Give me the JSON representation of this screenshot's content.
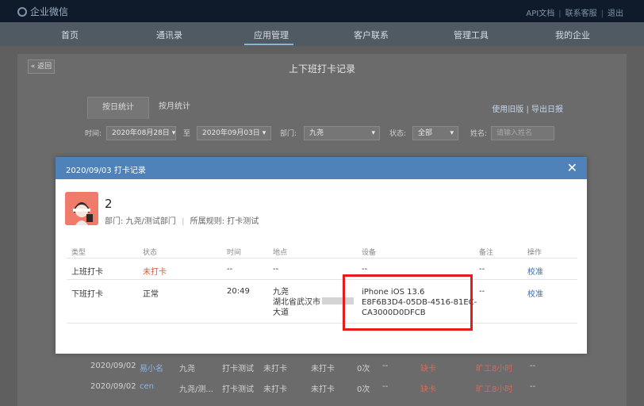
{
  "app": {
    "title": "企业微信",
    "toplinks": [
      "API文档",
      "联系客服",
      "退出"
    ]
  },
  "nav": {
    "items": [
      "首页",
      "通讯录",
      "应用管理",
      "客户联系",
      "管理工具",
      "我的企业"
    ],
    "active": "应用管理"
  },
  "page": {
    "back_label": "« 返回",
    "title": "上下班打卡记录"
  },
  "tabs": {
    "daily": "按日统计",
    "monthly": "按月统计",
    "right_links": [
      "使用旧版",
      "导出日报"
    ]
  },
  "filters": {
    "time_label": "时间:",
    "start_date": "2020年08月28日",
    "to_label": "至",
    "end_date": "2020年09月03日",
    "dept_label": "部门:",
    "dept_value": "九尧",
    "status_label": "状态:",
    "status_value": "全部",
    "name_label": "姓名:",
    "name_placeholder": "请输入姓名"
  },
  "background_rows": [
    {
      "date": "2020/09/02",
      "name": "易小名",
      "dept": "九尧",
      "rule": "打卡测试",
      "in": "未打卡",
      "out": "未打卡",
      "count": "0次",
      "dash1": "--",
      "lack": "缺卡",
      "absent": "旷工8小时",
      "dash2": "--"
    },
    {
      "date": "2020/09/02",
      "name": "cen",
      "dept": "九尧/测...",
      "rule": "打卡测试",
      "in": "未打卡",
      "out": "未打卡",
      "count": "0次",
      "dash1": "--",
      "lack": "缺卡",
      "absent": "旷工8小时",
      "dash2": "--"
    }
  ],
  "modal": {
    "title": "2020/09/03 打卡记录",
    "user": {
      "name": "2",
      "dept_label": "部门: 九尧/测试部门",
      "sep": "|",
      "rule_label": "所属规则: 打卡测试"
    },
    "columns": [
      "类型",
      "状态",
      "时间",
      "地点",
      "设备",
      "备注",
      "操作"
    ],
    "rows": [
      {
        "type": "上班打卡",
        "status": "未打卡",
        "time": "--",
        "location": "--",
        "device": "--",
        "note": "--",
        "action": "校准"
      },
      {
        "type": "下班打卡",
        "status": "正常",
        "time": "20:49",
        "location_line1": "九尧",
        "location_line2": "湖北省武汉市",
        "location_line3": "大道",
        "device_line1": "iPhone iOS 13.6",
        "device_line2": "E8F6B3D4-05DB-4516-81EC-",
        "device_line3": "CA3000D0DFCB",
        "note": "--",
        "action": "校准"
      }
    ]
  },
  "colors": {
    "topbar": "#0f1b2a",
    "modal_header": "#4f82b9",
    "highlight": "#e31c1c",
    "link": "#2e6ebd",
    "warning": "#e4553d"
  }
}
